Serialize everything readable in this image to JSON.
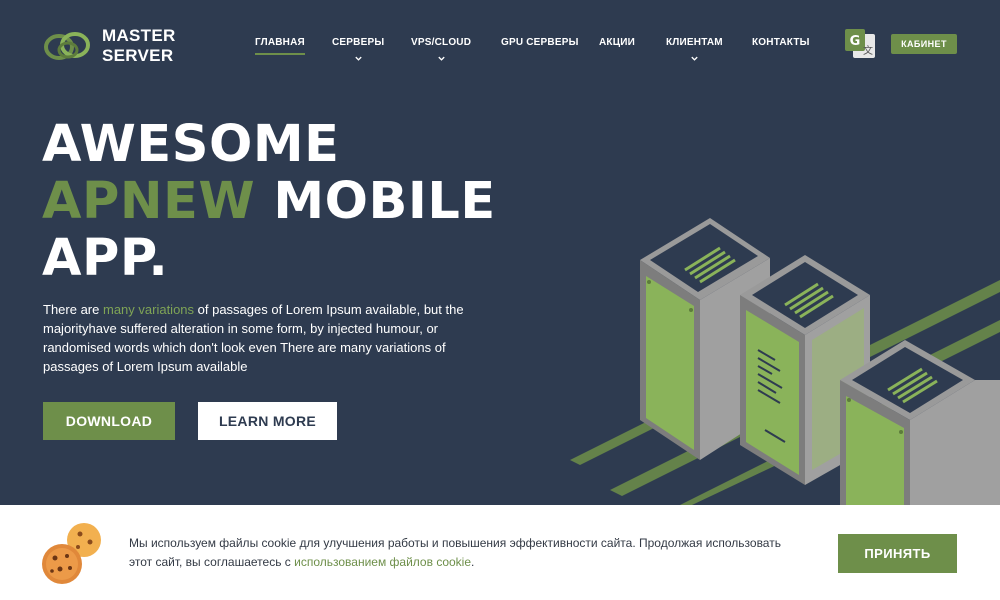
{
  "brand": {
    "line1": "MASTER",
    "line2": "SERVER",
    "accent_color": "#6e8f4a",
    "background_color": "#2e3b50"
  },
  "nav": {
    "items": [
      {
        "label": "ГЛАВНАЯ",
        "active": true,
        "dropdown": false
      },
      {
        "label": "СЕРВЕРЫ",
        "active": false,
        "dropdown": true
      },
      {
        "label": "VPS/CLOUD",
        "active": false,
        "dropdown": true
      },
      {
        "label": "GPU СЕРВЕРЫ",
        "active": false,
        "dropdown": false
      },
      {
        "label": "АКЦИИ",
        "active": false,
        "dropdown": false
      },
      {
        "label": "КЛИЕНТАМ",
        "active": false,
        "dropdown": true
      },
      {
        "label": "КОНТАКТЫ",
        "active": false,
        "dropdown": false
      }
    ],
    "translate_icon": "google-translate-icon",
    "cabinet_label": "КАБИНЕТ"
  },
  "hero": {
    "line1": "AWESOME",
    "line2_accent": "APNEW",
    "line2_rest": "MOBILE",
    "line3": "APP.",
    "desc_before": "There are ",
    "desc_link": "many variations",
    "desc_after": " of passages of Lorem Ipsum available, but the majorityhave suffered alteration in some form, by injected humour, or randomised words which don't look even There are many variations of passages of Lorem Ipsum available",
    "download_label": "DOWNLOAD",
    "learn_more_label": "LEARN MORE"
  },
  "cookie": {
    "text_before": "Мы используем файлы cookie для улучшения работы и повышения эффективности сайта. Продолжая использовать этот сайт, вы соглашаетесь с ",
    "link": "использованием файлов cookie",
    "text_after": ".",
    "accept_label": "ПРИНЯТЬ",
    "icon": "cookies-icon"
  }
}
